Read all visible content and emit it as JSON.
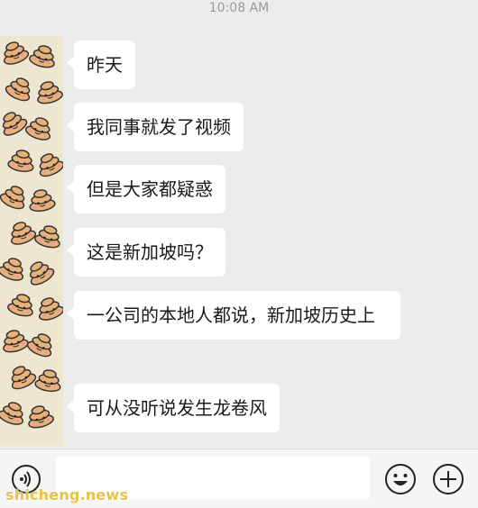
{
  "status": {
    "time": "10:08 AM"
  },
  "messages": [
    {
      "text": "昨天"
    },
    {
      "text": "我同事就发了视频"
    },
    {
      "text": "但是大家都疑惑"
    },
    {
      "text": "这是新加坡吗？"
    },
    {
      "text": "一公司的本地人都说，新加坡历史上"
    },
    {
      "text": "可从没听说发生龙卷风"
    }
  ],
  "input_bar": {
    "text_value": "",
    "icons": [
      "voice-icon",
      "emoji-icon",
      "plus-icon"
    ]
  },
  "watermark": {
    "text": "shicheng.news"
  },
  "colors": {
    "background": "#ececec",
    "bubble": "#ffffff",
    "watermark": "#e8c24a"
  }
}
